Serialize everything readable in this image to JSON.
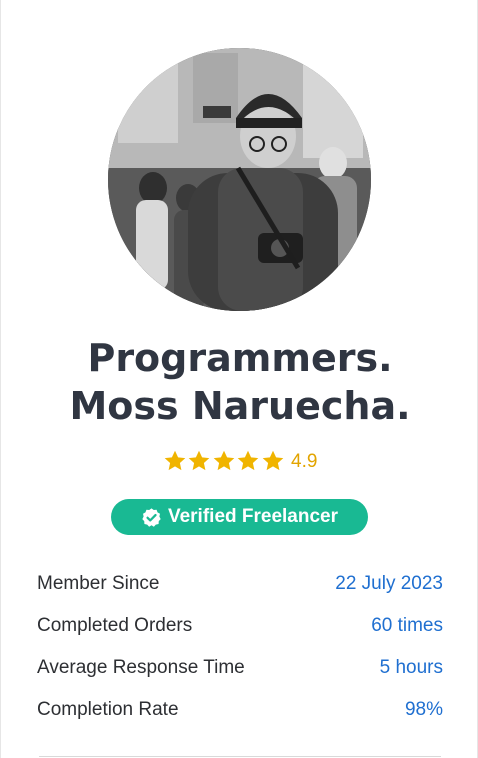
{
  "profile": {
    "avatar_alt": "",
    "name_line1": "Programmers.",
    "name_line2": "Moss Naruecha.",
    "rating": "4.9",
    "stars": 5,
    "badge_label": "Verified Freelancer",
    "badge_icon": "check-circle-icon"
  },
  "stats": [
    {
      "label": "Member Since",
      "value": "22 July 2023"
    },
    {
      "label": "Completed Orders",
      "value": "60 times"
    },
    {
      "label": "Average Response Time",
      "value": "5 hours"
    },
    {
      "label": "Completion Rate",
      "value": "98%"
    }
  ],
  "colors": {
    "star": "#f0b400",
    "rating_text": "#e2a400",
    "badge_bg": "#19b993",
    "value_text": "#1f6fd0",
    "name_text": "#303642"
  }
}
